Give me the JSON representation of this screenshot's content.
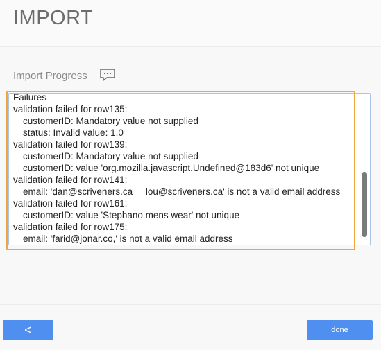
{
  "header": {
    "title": "IMPORT"
  },
  "progress": {
    "label": "Import Progress",
    "icon": "chat-bubble-icon",
    "log_lines": [
      {
        "text": "Failures",
        "indent": false
      },
      {
        "text": "validation failed for row135:",
        "indent": false
      },
      {
        "text": "customerID: Mandatory value not supplied",
        "indent": true
      },
      {
        "text": "status: Invalid value: 1.0",
        "indent": true
      },
      {
        "text": "validation failed for row139:",
        "indent": false
      },
      {
        "text": "customerID: Mandatory value not supplied",
        "indent": true
      },
      {
        "text": "customerID: value 'org.mozilla.javascript.Undefined@183d6' not unique",
        "indent": true
      },
      {
        "text": "validation failed for row141:",
        "indent": false
      },
      {
        "text": "email: 'dan@scriveners.ca     lou@scriveners.ca' is not a valid email address",
        "indent": true
      },
      {
        "text": "validation failed for row161:",
        "indent": false
      },
      {
        "text": "customerID: value 'Stephano mens wear' not unique",
        "indent": true
      },
      {
        "text": "validation failed for row175:",
        "indent": false
      },
      {
        "text": "email: 'farid@jonar.co,' is not a valid email address",
        "indent": true
      }
    ]
  },
  "footer": {
    "back_label": "<",
    "done_label": "done"
  },
  "colors": {
    "accent": "#4f8ff0",
    "highlight": "#f0a742",
    "text": "#222222",
    "muted": "#8a8a8a"
  }
}
